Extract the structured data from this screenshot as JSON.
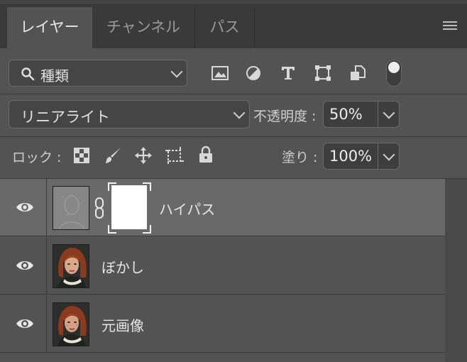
{
  "tabs": [
    {
      "label": "レイヤー",
      "active": true
    },
    {
      "label": "チャンネル",
      "active": false
    },
    {
      "label": "パス",
      "active": false
    }
  ],
  "filter": {
    "label": "種類"
  },
  "filter_icons": [
    "image-filter-icon",
    "adjustment-filter-icon",
    "type-filter-icon",
    "shape-filter-icon",
    "smart-object-filter-icon"
  ],
  "blend_mode": {
    "label": "リニアライト"
  },
  "opacity": {
    "label": "不透明度 :",
    "value": "50%"
  },
  "lock": {
    "label": "ロック :"
  },
  "fill": {
    "label": "塗り :",
    "value": "100%"
  },
  "layers": [
    {
      "name": "ハイパス",
      "selected": true,
      "has_mask": true,
      "visible": true
    },
    {
      "name": "ぼかし",
      "selected": false,
      "has_mask": false,
      "visible": true
    },
    {
      "name": "元画像",
      "selected": false,
      "has_mask": false,
      "visible": true
    }
  ],
  "colors": {
    "panel_bg": "#535353",
    "selected_row": "#696969",
    "tabbar_bg": "#3a3a3a"
  }
}
